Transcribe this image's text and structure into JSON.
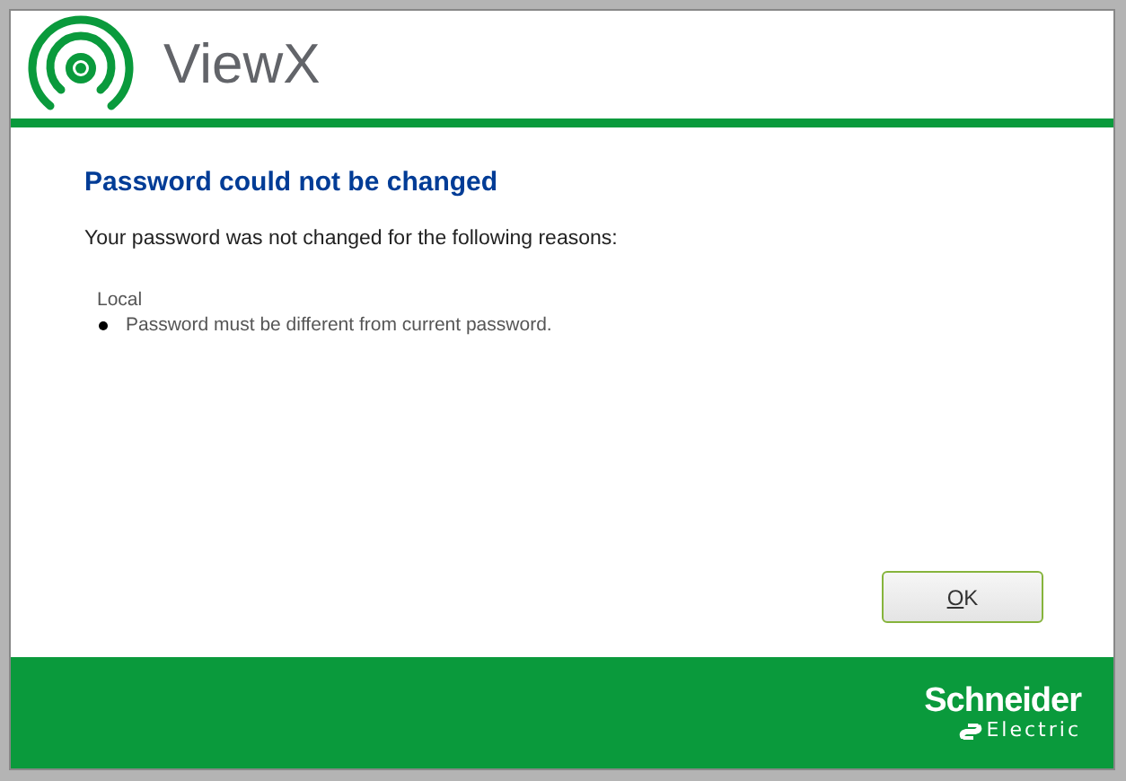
{
  "app_title": "ViewX",
  "heading": "Password could not be changed",
  "message": "Your password was not changed for the following reasons:",
  "reasons": [
    {
      "source": "Local",
      "items": [
        "Password must be different from current password."
      ]
    }
  ],
  "buttons": [
    {
      "label": "OK",
      "kind": "default"
    }
  ],
  "footer": {
    "brand": "Schneider",
    "brand_sub": "Electric"
  }
}
